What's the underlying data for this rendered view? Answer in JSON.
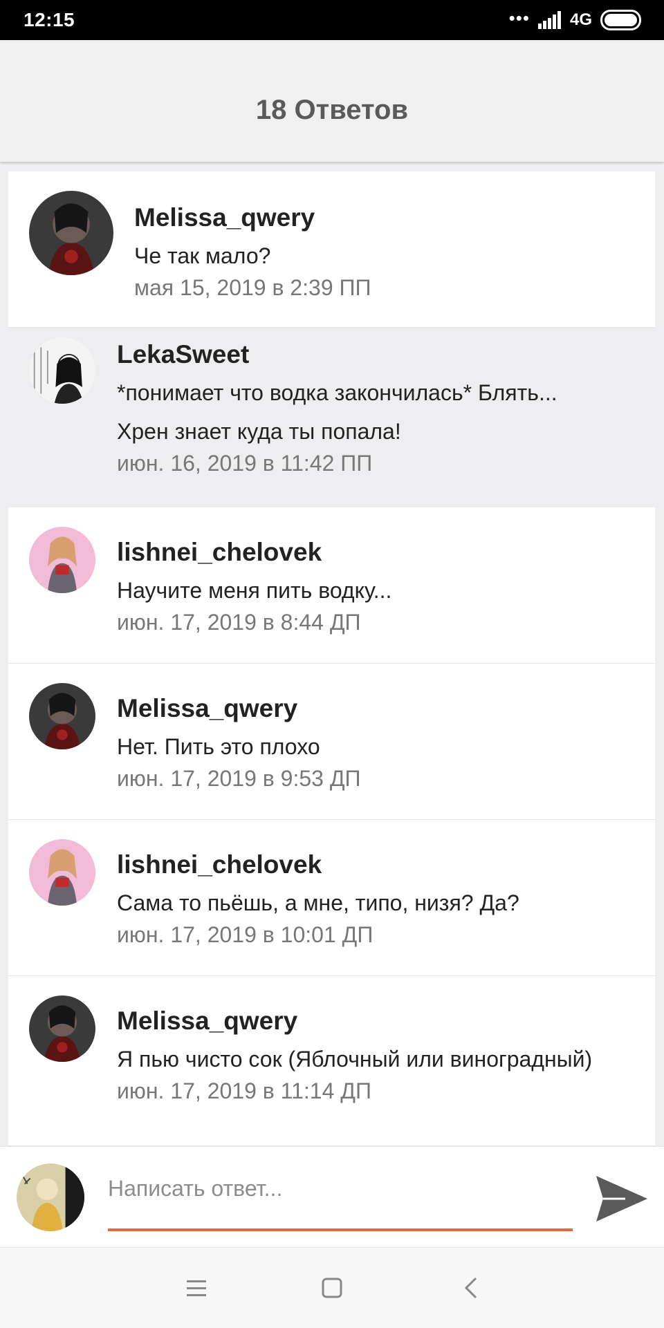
{
  "status_bar": {
    "time": "12:15",
    "network": "4G"
  },
  "header": {
    "title": "18 Ответов"
  },
  "replies": [
    {
      "author": "Melissa_qwery",
      "lines": [
        "Че так мало?"
      ],
      "date": "мая 15, 2019 в 2:39 ПП",
      "avatar": "dark-character-avatar"
    },
    {
      "author": "LekaSweet",
      "lines": [
        "*понимает что водка закончилась* Блять...",
        "Хрен знает куда ты попала!"
      ],
      "date": "июн. 16, 2019 в 11:42 ПП",
      "avatar": "sketch-character-avatar"
    },
    {
      "author": "lishnei_chelovek",
      "lines": [
        "Научите меня пить водку..."
      ],
      "date": "июн. 17, 2019 в 8:44 ДП",
      "avatar": "pink-character-avatar"
    },
    {
      "author": "Melissa_qwery",
      "lines": [
        "Нет. Пить это плохо"
      ],
      "date": "июн. 17, 2019 в 9:53 ДП",
      "avatar": "dark-character-avatar"
    },
    {
      "author": "lishnei_chelovek",
      "lines": [
        "Сама то пьёшь, а мне, типо, низя? Да?"
      ],
      "date": "июн. 17, 2019 в 10:01 ДП",
      "avatar": "pink-character-avatar"
    },
    {
      "author": "Melissa_qwery",
      "lines": [
        "Я пью чисто сок (Яблочный или виноградный)"
      ],
      "date": "июн. 17, 2019 в 11:14 ДП",
      "avatar": "dark-character-avatar"
    }
  ],
  "composer": {
    "placeholder": "Написать ответ..."
  },
  "colors": {
    "accent": "#e8683a",
    "header_bg": "#f0f0f0",
    "list_bg": "#eeeef0"
  },
  "icons": {
    "send": "send-icon",
    "menu": "menu-icon",
    "home": "home-icon",
    "back": "back-icon"
  }
}
